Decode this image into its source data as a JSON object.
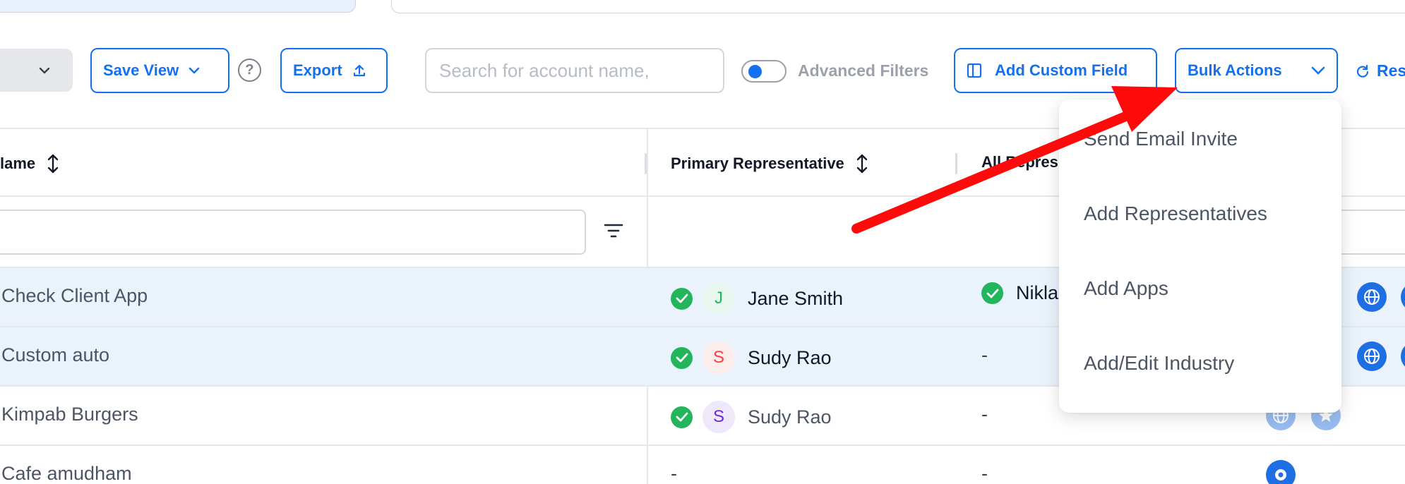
{
  "toolbar": {
    "save_view_label": "Save View",
    "help_symbol": "?",
    "export_label": "Export",
    "search_placeholder": "Search for account name,",
    "advanced_filters_label": "Advanced Filters",
    "add_custom_field_label": "Add Custom Field",
    "bulk_actions_label": "Bulk Actions",
    "refresh_label": "Res"
  },
  "table": {
    "columns": [
      {
        "label": "lame"
      },
      {
        "label": "Primary Representative"
      },
      {
        "label": "All Repres"
      }
    ],
    "rows": [
      {
        "name": "Check Client App",
        "selected": true,
        "primary": {
          "name": "Jane Smith",
          "initial": "J",
          "verified": true
        },
        "all_reps": "Niklas"
      },
      {
        "name": "Custom auto",
        "selected": true,
        "primary": {
          "name": "Sudy Rao",
          "initial": "S",
          "verified": true
        },
        "all_reps": "-"
      },
      {
        "name": "Kimpab Burgers",
        "selected": false,
        "primary": {
          "name": "Sudy Rao",
          "initial": "S",
          "verified": true
        },
        "all_reps": "-"
      },
      {
        "name": "Cafe amudham",
        "selected": false,
        "primary": {
          "name": "-"
        },
        "all_reps": "-"
      }
    ]
  },
  "bulk_menu": {
    "items": [
      "Send Email Invite",
      "Add Representatives",
      "Add Apps",
      "Add/Edit Industry"
    ]
  },
  "colors": {
    "accent": "#1570ef",
    "selected_row": "#eaf3fc",
    "verified": "#22b55c",
    "annotation_arrow": "#ff0a0a"
  },
  "icons": [
    "chevron-down-icon",
    "help-icon",
    "upload-icon",
    "columns-icon",
    "refresh-icon",
    "sort-icon",
    "filter-icon",
    "check-icon",
    "globe-icon",
    "star-icon",
    "location-icon"
  ]
}
